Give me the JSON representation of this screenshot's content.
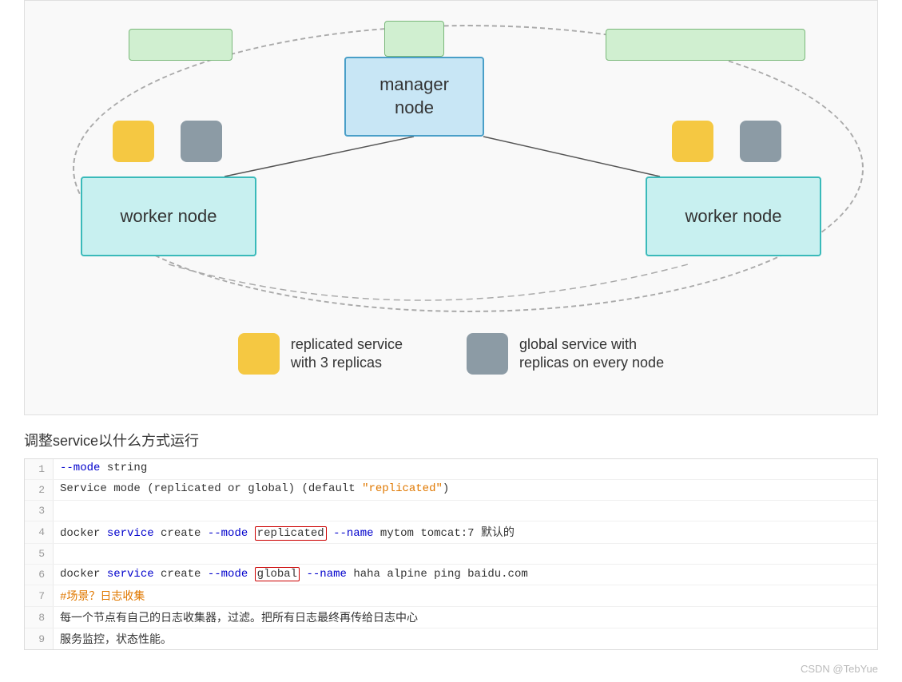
{
  "diagram": {
    "manager_label": "manager\nnode",
    "worker_left_label": "worker node",
    "worker_right_label": "worker node",
    "legend": [
      {
        "color": "yellow",
        "text": "replicated service\nwith 3 replicas"
      },
      {
        "color": "gray",
        "text": "global service with\nreplicas on every node"
      }
    ]
  },
  "section_title": "调整service以什么方式运行",
  "code_lines": [
    {
      "num": "1",
      "content": "--mode string"
    },
    {
      "num": "2",
      "content": "Service mode (replicated or global) (default \"replicated\")"
    },
    {
      "num": "3",
      "content": ""
    },
    {
      "num": "4",
      "content": "docker service create --mode replicated --name mytom tomcat:7 默认的"
    },
    {
      "num": "5",
      "content": ""
    },
    {
      "num": "6",
      "content": "docker service create --mode global --name haha alpine ping baidu.com"
    },
    {
      "num": "7",
      "content": "#场景？日志收集"
    },
    {
      "num": "8",
      "content": "每一个节点有自己的日志收集器，过滤。把所有日志最终再传给日志中心"
    },
    {
      "num": "9",
      "content": "服务监控，状态性能。"
    }
  ],
  "watermark": "CSDN @TebYue"
}
